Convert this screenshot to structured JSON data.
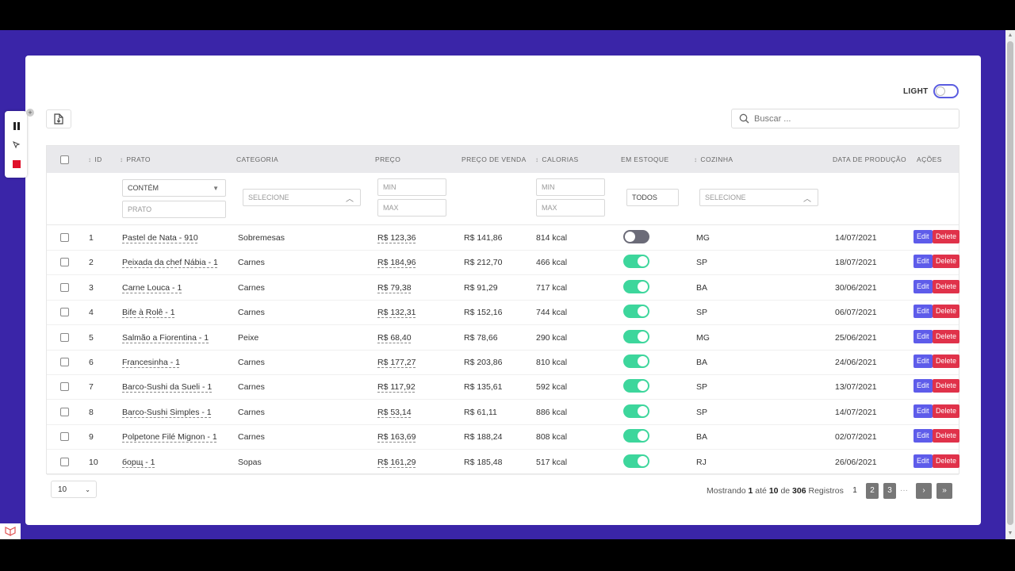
{
  "theme_toggle": {
    "label": "LIGHT",
    "enabled": false
  },
  "search": {
    "placeholder": "Buscar ..."
  },
  "columns": {
    "id": "ID",
    "prato": "PRATO",
    "categoria": "CATEGORIA",
    "preco": "PREÇO",
    "preco_venda": "PREÇO DE VENDA",
    "calorias": "CALORIAS",
    "estoque": "EM ESTOQUE",
    "cozinha": "COZINHA",
    "data": "DATA DE PRODUÇÃO",
    "acoes": "AÇÕES"
  },
  "filters": {
    "prato_mode": "CONTÉM",
    "prato_placeholder": "PRATO",
    "categoria_placeholder": "SELECIONE",
    "preco_min": "MIN",
    "preco_max": "MAX",
    "cal_min": "MIN",
    "cal_max": "MAX",
    "estoque": "TODOS",
    "cozinha_placeholder": "SELECIONE"
  },
  "rows": [
    {
      "id": "1",
      "prato": "Pastel de Nata - 910",
      "categoria": "Sobremesas",
      "preco": "R$ 123,36",
      "venda": "R$ 141,86",
      "cal": "814 kcal",
      "estoque": false,
      "cozinha": "MG",
      "data": "14/07/2021"
    },
    {
      "id": "2",
      "prato": "Peixada da chef Nábia - 1",
      "categoria": "Carnes",
      "preco": "R$ 184,96",
      "venda": "R$ 212,70",
      "cal": "466 kcal",
      "estoque": true,
      "cozinha": "SP",
      "data": "18/07/2021"
    },
    {
      "id": "3",
      "prato": "Carne Louca - 1",
      "categoria": "Carnes",
      "preco": "R$ 79,38",
      "venda": "R$ 91,29",
      "cal": "717 kcal",
      "estoque": true,
      "cozinha": "BA",
      "data": "30/06/2021"
    },
    {
      "id": "4",
      "prato": "Bife à Rolê - 1",
      "categoria": "Carnes",
      "preco": "R$ 132,31",
      "venda": "R$ 152,16",
      "cal": "744 kcal",
      "estoque": true,
      "cozinha": "SP",
      "data": "06/07/2021"
    },
    {
      "id": "5",
      "prato": "Salmão a Fiorentina - 1",
      "categoria": "Peixe",
      "preco": "R$ 68,40",
      "venda": "R$ 78,66",
      "cal": "290 kcal",
      "estoque": true,
      "cozinha": "MG",
      "data": "25/06/2021"
    },
    {
      "id": "6",
      "prato": "Francesinha - 1",
      "categoria": "Carnes",
      "preco": "R$ 177,27",
      "venda": "R$ 203,86",
      "cal": "810 kcal",
      "estoque": true,
      "cozinha": "BA",
      "data": "24/06/2021"
    },
    {
      "id": "7",
      "prato": "Barco-Sushi da Sueli - 1",
      "categoria": "Carnes",
      "preco": "R$ 117,92",
      "venda": "R$ 135,61",
      "cal": "592 kcal",
      "estoque": true,
      "cozinha": "SP",
      "data": "13/07/2021"
    },
    {
      "id": "8",
      "prato": "Barco-Sushi Simples - 1",
      "categoria": "Carnes",
      "preco": "R$ 53,14",
      "venda": "R$ 61,11",
      "cal": "886 kcal",
      "estoque": true,
      "cozinha": "SP",
      "data": "14/07/2021"
    },
    {
      "id": "9",
      "prato": "Polpetone Filé Mignon - 1",
      "categoria": "Carnes",
      "preco": "R$ 163,69",
      "venda": "R$ 188,24",
      "cal": "808 kcal",
      "estoque": true,
      "cozinha": "BA",
      "data": "02/07/2021"
    },
    {
      "id": "10",
      "prato": "борщ - 1",
      "categoria": "Sopas",
      "preco": "R$ 161,29",
      "venda": "R$ 185,48",
      "cal": "517 kcal",
      "estoque": true,
      "cozinha": "RJ",
      "data": "26/06/2021"
    }
  ],
  "actions": {
    "edit": "Edit",
    "delete": "Delete"
  },
  "pagination": {
    "page_size": "10",
    "showing_prefix": "Mostrando",
    "from": "1",
    "mid": "até",
    "to": "10",
    "of": "de",
    "total": "306",
    "suffix": "Registros",
    "pages": [
      "1",
      "2",
      "3"
    ],
    "current": "1",
    "ellipsis": "···",
    "next": "›",
    "last": "»"
  },
  "colors": {
    "accent": "#5e5cea",
    "danger": "#e0324a",
    "toggle_on": "#3dd69c",
    "background": "#3a25a8"
  }
}
